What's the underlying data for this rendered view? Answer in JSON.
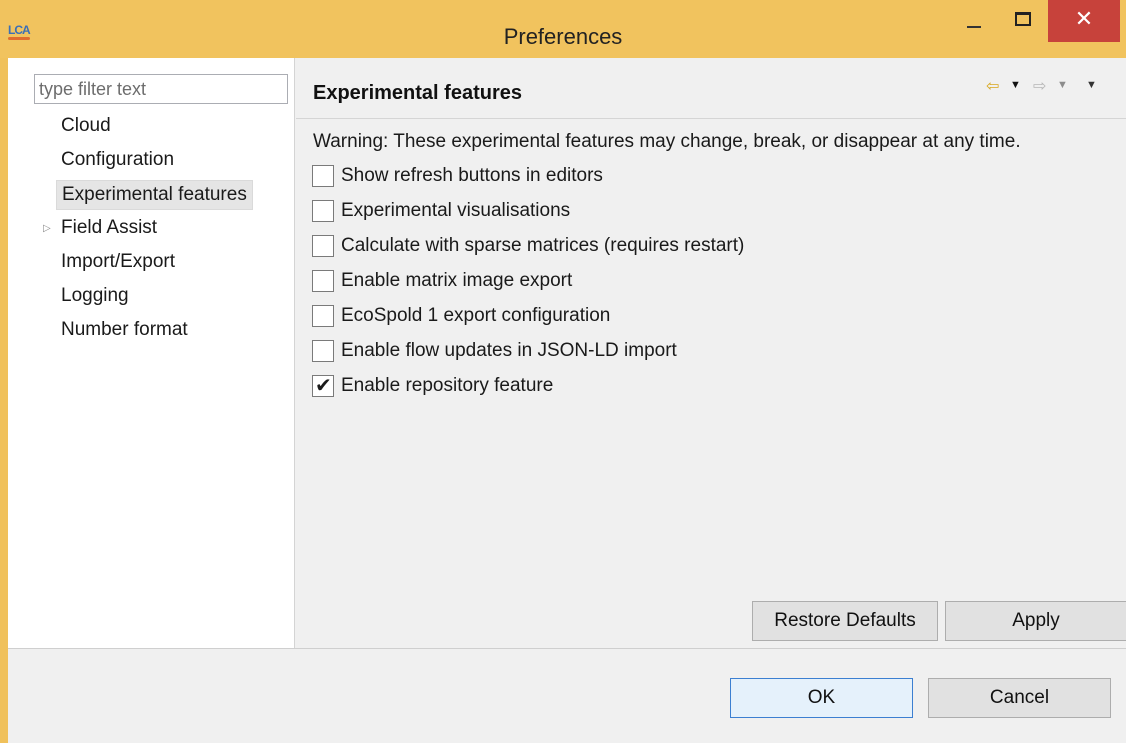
{
  "window": {
    "title": "Preferences",
    "app_icon_text": "LCA",
    "controls": {
      "minimize": "minimize",
      "maximize": "maximize",
      "close": "✕"
    }
  },
  "filter": {
    "placeholder": "type filter text",
    "value": ""
  },
  "nav": {
    "items": [
      {
        "label": "Cloud",
        "selected": false,
        "expandable": false
      },
      {
        "label": "Configuration",
        "selected": false,
        "expandable": false
      },
      {
        "label": "Experimental features",
        "selected": true,
        "expandable": false
      },
      {
        "label": "Field Assist",
        "selected": false,
        "expandable": true
      },
      {
        "label": "Import/Export",
        "selected": false,
        "expandable": false
      },
      {
        "label": "Logging",
        "selected": false,
        "expandable": false
      },
      {
        "label": "Number format",
        "selected": false,
        "expandable": false
      }
    ],
    "expand_glyph": "▷"
  },
  "page": {
    "title": "Experimental features",
    "history": {
      "back_icon": "⇦",
      "forward_icon": "⇨",
      "dropdown_icon": "▼"
    },
    "warning": "Warning: These experimental features may change, break, or disappear at any time.",
    "options": [
      {
        "label": "Show refresh buttons in editors",
        "checked": false
      },
      {
        "label": "Experimental visualisations",
        "checked": false
      },
      {
        "label": "Calculate with sparse matrices (requires restart)",
        "checked": false
      },
      {
        "label": "Enable matrix image export",
        "checked": false
      },
      {
        "label": "EcoSpold 1 export configuration",
        "checked": false
      },
      {
        "label": "Enable flow updates in JSON-LD import",
        "checked": false
      },
      {
        "label": "Enable repository feature",
        "checked": true
      }
    ],
    "check_mark": "✔",
    "restore_defaults_label": "Restore Defaults",
    "apply_label": "Apply"
  },
  "footer": {
    "ok_label": "OK",
    "cancel_label": "Cancel"
  },
  "colors": {
    "titlebar": "#f1c35e",
    "close_button": "#c7423b",
    "selection": "#e5e5e5",
    "ok_border": "#3c7fd1"
  }
}
